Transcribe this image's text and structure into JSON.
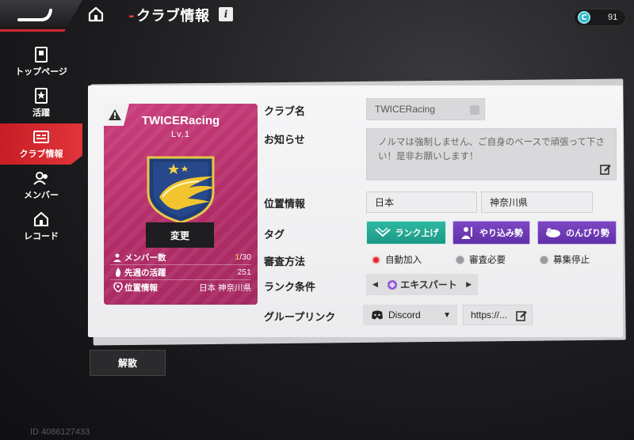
{
  "header": {
    "page_title": "クラブ情報",
    "title_prefix": "-",
    "info_label": "i",
    "currency_value": "91",
    "currency_symbol": "C"
  },
  "sidebar": {
    "items": [
      {
        "label": "トップページ",
        "icon": "card-icon",
        "active": false
      },
      {
        "label": "活躍",
        "icon": "star-list-icon",
        "active": false
      },
      {
        "label": "クラブ情報",
        "icon": "club-info-icon",
        "active": true
      },
      {
        "label": "メンバー",
        "icon": "members-icon",
        "active": false
      },
      {
        "label": "レコード",
        "icon": "home-record-icon",
        "active": false
      }
    ]
  },
  "club_card": {
    "name": "TWICERacing",
    "level": "Lv.1",
    "change_button": "変更",
    "stats": [
      {
        "label": "メンバー数",
        "value_current": "1",
        "value_total": "/30"
      },
      {
        "label": "先週の活躍",
        "value": "251"
      },
      {
        "label": "位置情報",
        "value": "日本 神奈川県"
      }
    ],
    "colors": {
      "card": "#b8306c",
      "emblem_blue": "#1f3d78",
      "emblem_gold": "#f0c52e"
    }
  },
  "form": {
    "club_name_label": "クラブ名",
    "club_name_value": "TWICERacing",
    "notice_label": "お知らせ",
    "notice_value": "ノルマは強制しません、ご自身のベースで頑張って下さい！是非お願いします！",
    "location_label": "位置情報",
    "location_country": "日本",
    "location_region": "神奈川県",
    "tag_label": "タグ",
    "tags": [
      "ランク上げ",
      "やり込み勢",
      "のんびり勢"
    ],
    "review_label": "審査方法",
    "review_options": [
      {
        "label": "自動加入",
        "selected": true
      },
      {
        "label": "審査必要",
        "selected": false
      },
      {
        "label": "募集停止",
        "selected": false
      }
    ],
    "rank_label": "ランク条件",
    "rank_value": "エキスパート",
    "group_link_label": "グループリンク",
    "group_link_platform": "Discord",
    "group_link_url": "https://..."
  },
  "dissolve_button": "解散",
  "player_id": "ID 4086127433"
}
